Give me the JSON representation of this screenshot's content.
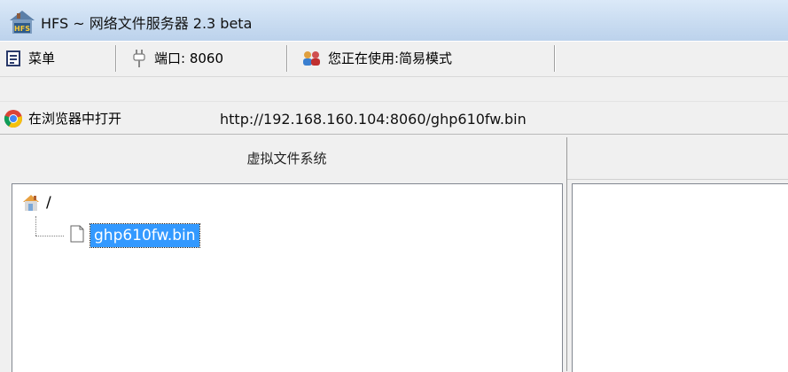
{
  "window": {
    "title": "HFS ~ 网络文件服务器 2.3 beta",
    "app_icon": "hfs-house-icon"
  },
  "toolbar": {
    "menu_label": "菜单",
    "port_label": "端口: 8060",
    "mode_label": "您正在使用:简易模式"
  },
  "urlbar": {
    "open_button_label": "在浏览器中打开",
    "url": "http://192.168.160.104:8060/ghp610fw.bin"
  },
  "vfs": {
    "header": "虚拟文件系统",
    "root_label": "/",
    "files": [
      {
        "name": "ghp610fw.bin",
        "selected": true
      }
    ]
  },
  "colors": {
    "selection": "#3399ff",
    "titlebar": "#c9dcf1"
  }
}
